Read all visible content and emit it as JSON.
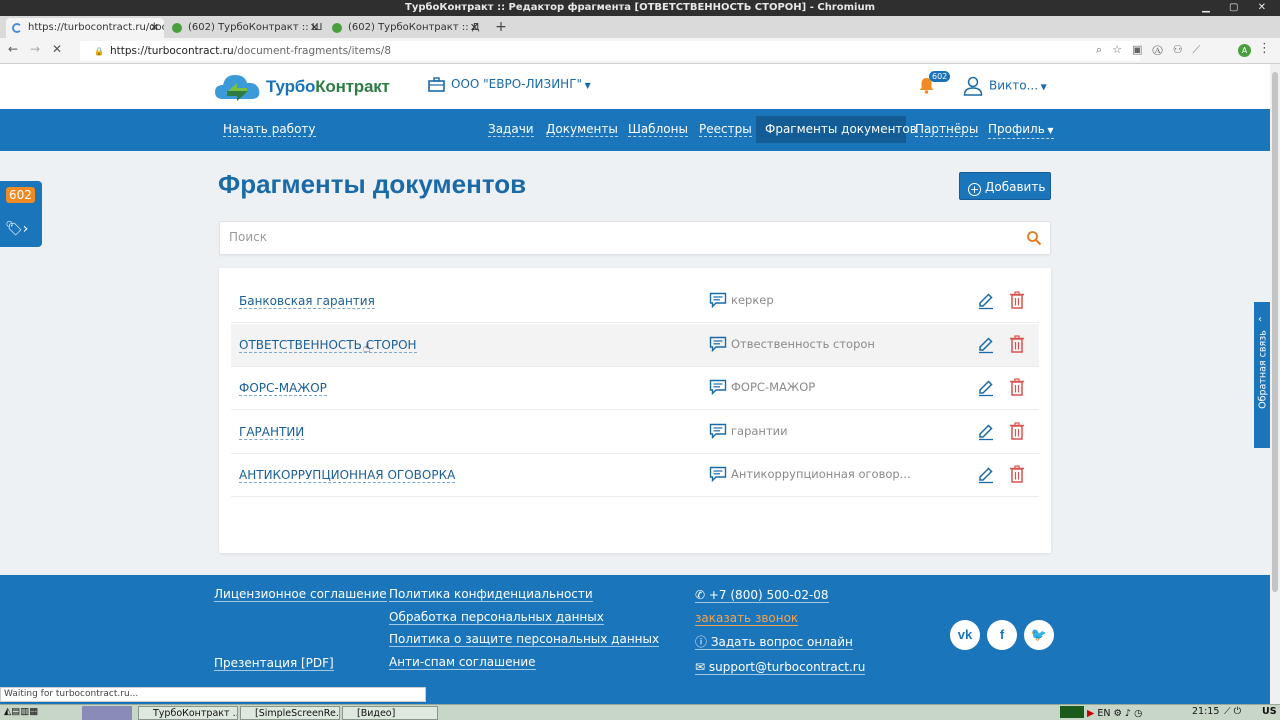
{
  "window": {
    "title": "ТурбоКонтракт :: Редактор фрагмента [ОТВЕТСТВЕННОСТЬ СТОРОН] - Chromium"
  },
  "browser": {
    "tabs": [
      {
        "label": "https://turbocontract.ru/doc",
        "active": true
      },
      {
        "label": "(602) ТурбоКонтракт :: Ш",
        "active": false
      },
      {
        "label": "(602) ТурбоКонтракт :: Д",
        "active": false
      }
    ],
    "url_host": "https://turbocontract.ru",
    "url_path": "/document-fragments/items/8",
    "status": "Waiting for turbocontract.ru..."
  },
  "header": {
    "logo_part1": "Турбо",
    "logo_part2": "Контракт",
    "org": "ООО \"ЕВРО-ЛИЗИНГ\"",
    "notifications": "602",
    "user": "Викто..."
  },
  "nav": {
    "start": "Начать работу",
    "items": [
      "Задачи",
      "Документы",
      "Шаблоны",
      "Реестры",
      "Фрагменты документов",
      "Партнёры",
      "Профиль"
    ]
  },
  "side": {
    "count": "602",
    "feedback": "Обратная связь"
  },
  "main": {
    "title": "Фрагменты документов",
    "add_label": "Добавить",
    "search_placeholder": "Поиск",
    "rows": [
      {
        "name": "Банковская гарантия",
        "desc": "керкер"
      },
      {
        "name": "ОТВЕТСТВЕННОСТЬ СТОРОН",
        "desc": "Отвественность сторон"
      },
      {
        "name": "ФОРС-МАЖОР",
        "desc": "ФОРС-МАЖОР"
      },
      {
        "name": "ГАРАНТИИ",
        "desc": "гарантии"
      },
      {
        "name": "АНТИКОРРУПЦИОННАЯ ОГОВОРКА",
        "desc": "Антикоррупционная оговор..."
      }
    ]
  },
  "footer": {
    "license": "Лицензионное соглашение",
    "presentation": "Презентация [PDF]",
    "privacy": "Политика конфиденциальности",
    "personal_data": "Обработка персональных данных",
    "data_protection": "Политика о защите персональных данных",
    "antispam": "Анти-спам соглашение",
    "phone": "+7 (800) 500-02-08",
    "callback": "заказать звонок",
    "ask": "Задать вопрос онлайн",
    "email": "support@turbocontract.ru"
  },
  "taskbar": {
    "items": [
      "ТурбоКонтракт ...",
      "[SimpleScreenRe...",
      "[Видео]"
    ],
    "lang": "EN",
    "clock": "21:15",
    "layout": "US"
  },
  "colors": {
    "brand_blue": "#1b75bb",
    "accent_orange": "#f08a24",
    "delete_red": "#d9534f"
  }
}
